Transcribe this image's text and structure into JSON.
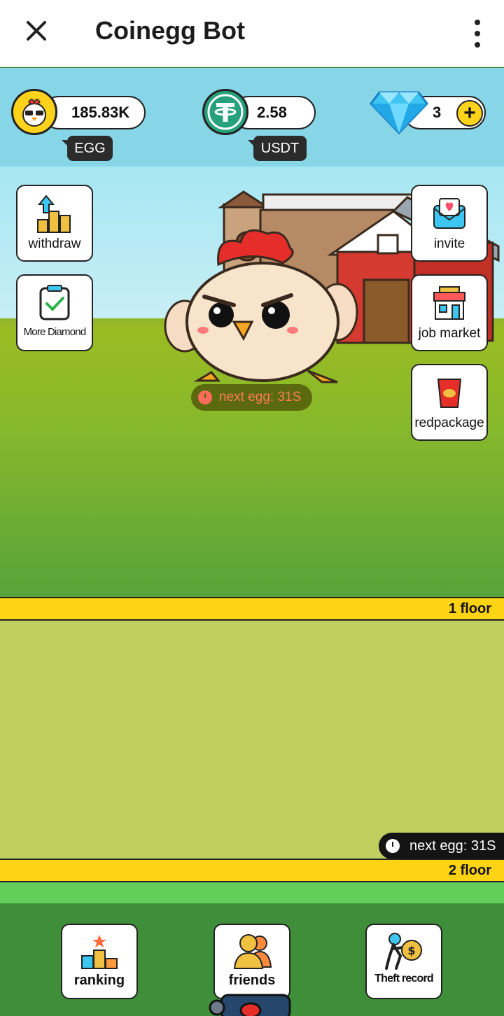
{
  "header": {
    "title": "Coinegg Bot",
    "close_icon": "close-icon",
    "more_icon": "more-vertical-icon"
  },
  "currencies": {
    "egg": {
      "value": "185.83K",
      "label": "EGG",
      "icon": "chicken-coin-icon"
    },
    "usdt": {
      "value": "2.58",
      "label": "USDT",
      "icon": "tether-icon"
    },
    "diamond": {
      "value": "3",
      "icon": "diamond-icon",
      "add_label": "+"
    }
  },
  "left_buttons": [
    {
      "label": "withdraw",
      "icon": "withdraw-coins-icon"
    },
    {
      "label": "More Diamond",
      "icon": "clipboard-check-icon"
    }
  ],
  "right_buttons": [
    {
      "label": "invite",
      "icon": "invite-envelope-icon"
    },
    {
      "label": "job market",
      "icon": "shop-icon"
    },
    {
      "label": "redpackage",
      "icon": "red-package-icon"
    }
  ],
  "chicken": {
    "next_egg": "next egg: 31S"
  },
  "floors": [
    {
      "label": "1 floor",
      "next_egg": "next egg: 31S"
    },
    {
      "label": "2 floor"
    }
  ],
  "bottom_nav": [
    {
      "label": "ranking",
      "icon": "podium-icon"
    },
    {
      "label": "friends",
      "icon": "friends-icon"
    },
    {
      "label": "Theft record",
      "icon": "thief-icon"
    }
  ],
  "colors": {
    "accent_yellow": "#fed313",
    "sky": "#87d6e8",
    "grass": "#86b82c",
    "floor": "#becf60",
    "bottom": "#3f8f3a"
  }
}
